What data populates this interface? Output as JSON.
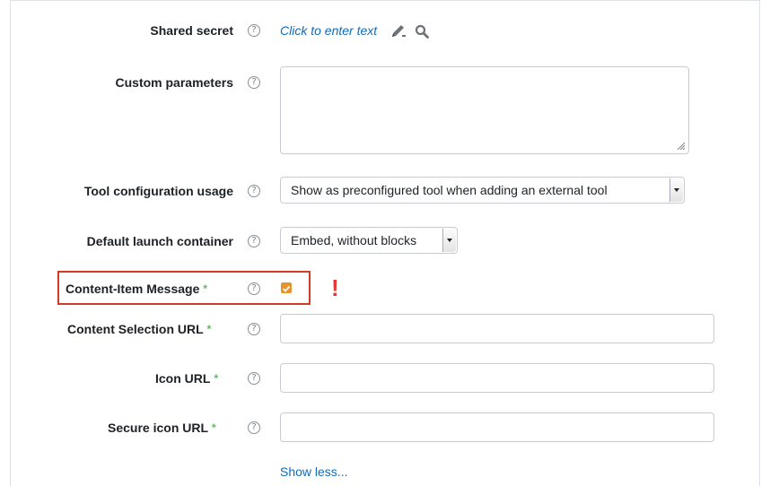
{
  "colors": {
    "link": "#0f6cbf",
    "required_marker": "#5cb85c",
    "checkbox_checked": "#e8932a",
    "highlight_box": "#d23c27",
    "exclamation": "#e53935"
  },
  "fields": {
    "shared_secret": {
      "label": "Shared secret",
      "value_link": "Click to enter text",
      "icons": [
        "pencil-icon",
        "search-icon"
      ]
    },
    "custom_parameters": {
      "label": "Custom parameters",
      "value": ""
    },
    "tool_configuration_usage": {
      "label": "Tool configuration usage",
      "selected": "Show as preconfigured tool when adding an external tool"
    },
    "default_launch_container": {
      "label": "Default launch container",
      "selected": "Embed, without blocks"
    },
    "content_item_message": {
      "label": "Content-Item Message",
      "required_marker": "*",
      "checked": true
    },
    "content_selection_url": {
      "label": "Content Selection URL",
      "required_marker": "*",
      "value": ""
    },
    "icon_url": {
      "label": "Icon URL",
      "required_marker": "*",
      "value": ""
    },
    "secure_icon_url": {
      "label": "Secure icon URL",
      "required_marker": "*",
      "value": ""
    }
  },
  "help_icon_glyph": "?",
  "annotation": {
    "exclamation": "!"
  },
  "show_less_link": "Show less..."
}
